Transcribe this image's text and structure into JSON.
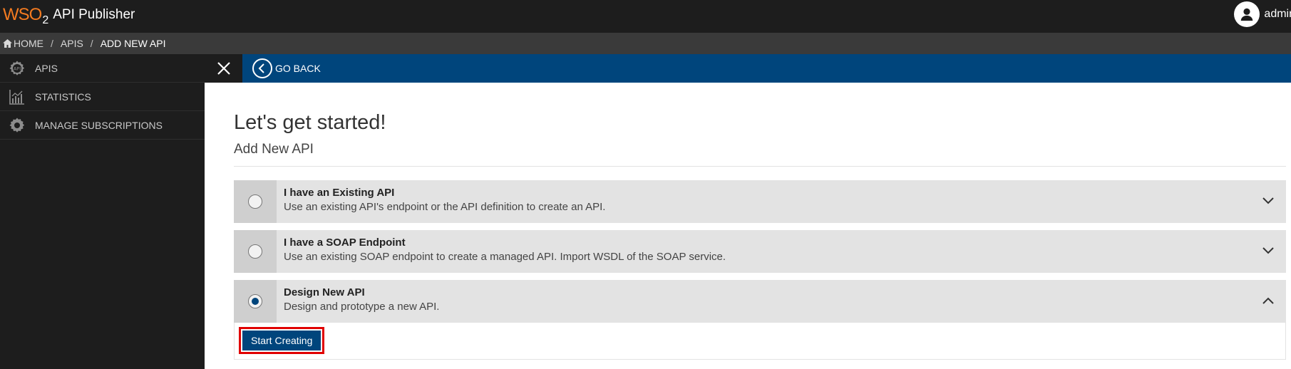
{
  "app": {
    "logo_text": "WSO",
    "logo_sub": "2",
    "title": "API Publisher",
    "user_name": "admin"
  },
  "breadcrumb": {
    "home": "HOME",
    "apis": "APIS",
    "current": "ADD NEW API",
    "separator": "/"
  },
  "sidebar": {
    "items": [
      {
        "label": "APIS",
        "icon": "api-gear-icon"
      },
      {
        "label": "STATISTICS",
        "icon": "chart-icon"
      },
      {
        "label": "MANAGE SUBSCRIPTIONS",
        "icon": "gear-icon"
      }
    ]
  },
  "actionbar": {
    "go_back": "GO BACK"
  },
  "page": {
    "heading": "Let's get started!",
    "subheading": "Add New API"
  },
  "options": [
    {
      "title": "I have an Existing API",
      "description": "Use an existing API's endpoint or the API definition to create an API.",
      "selected": false
    },
    {
      "title": "I have a SOAP Endpoint",
      "description": "Use an existing SOAP endpoint to create a managed API. Import WSDL of the SOAP service.",
      "selected": false
    },
    {
      "title": "Design New API",
      "description": "Design and prototype a new API.",
      "selected": true
    }
  ],
  "start_button": "Start Creating",
  "colors": {
    "brand_orange": "#f47b20",
    "primary_blue": "#00457c",
    "highlight_red": "#e00000"
  }
}
